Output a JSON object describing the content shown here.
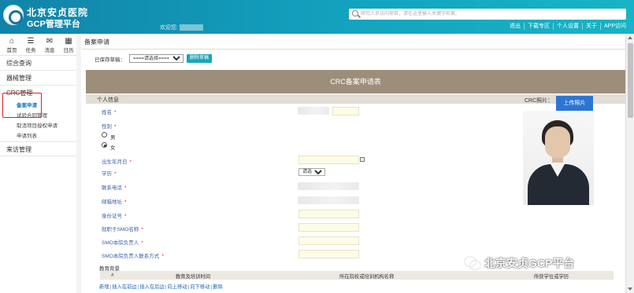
{
  "header": {
    "logo_line1": "北京安贞医院",
    "logo_line2": "GCP管理平台",
    "welcome_text": "欢迎您:",
    "search_placeholder": "研究人员访问项目，请在这里输入关键字检索。",
    "nav": [
      "退出",
      "下载专区",
      "个人设置",
      "关于",
      "APP访问"
    ]
  },
  "sidebar": {
    "quick": [
      {
        "label": "首页",
        "icon": "home-icon",
        "glyph": "⌂"
      },
      {
        "label": "任务",
        "icon": "task-icon",
        "glyph": "☰"
      },
      {
        "label": "消息",
        "icon": "message-icon",
        "glyph": "✉"
      },
      {
        "label": "日历",
        "icon": "calendar-icon",
        "glyph": "▦"
      }
    ],
    "menu1": "综合查询",
    "menu2": "器械管理",
    "menu3": "CRC管理",
    "crc_sub": [
      "备案申请",
      "试验合同管理",
      "取消项目授权申请",
      "申请列表"
    ],
    "menu4": "来访管理"
  },
  "main": {
    "page_title": "备案申请",
    "draft_label": "已保存草稿：",
    "draft_select": "====请选择====",
    "delete_draft": "删除草稿",
    "form_title": "CRC备案申请表",
    "section_personal": "个人信息",
    "crc_photo_label": "CRC照片：",
    "upload_photo": "上传照片",
    "fields": {
      "name": "姓名",
      "gender": "性别",
      "gender_male": "男",
      "gender_female": "女",
      "birth": "出生年月日",
      "education": "学历",
      "education_select": "请选择",
      "phone": "联系电话",
      "email": "邮箱地址",
      "id_card": "身份证号",
      "smo_name": "就职于SMO名称",
      "smo_head": "SMO本院负责人",
      "smo_head_contact": "SMO本院负责人联系方式"
    },
    "required_mark": "*",
    "edu_section": "教育背景",
    "edu_columns": [
      "#",
      "教育及培训时间",
      "所在院校或培训机构名称",
      "所获学位或学历"
    ],
    "edu_actions": [
      "新增",
      "插入在前边",
      "插入在后边",
      "向上移动",
      "向下移动",
      "删除"
    ],
    "action_sep": "|"
  },
  "watermark": "北京安贞GCP平台"
}
